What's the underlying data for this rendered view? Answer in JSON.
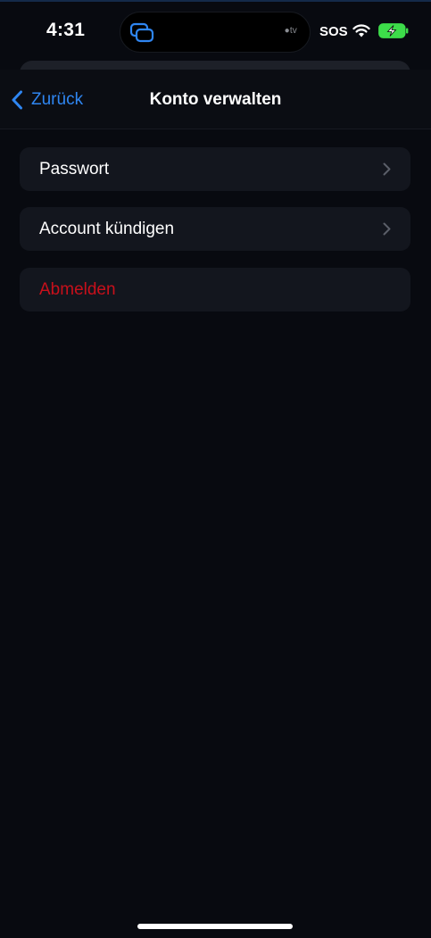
{
  "status_bar": {
    "time": "4:31",
    "island_label": "tv",
    "sos": "SOS",
    "icons": [
      "screen-mirroring-icon",
      "apple-tv-icon",
      "wifi-icon",
      "battery-charging-icon"
    ]
  },
  "nav": {
    "back_label": "Zurück",
    "title": "Konto verwalten"
  },
  "list": {
    "items": [
      {
        "label": "Passwort",
        "has_chevron": true
      },
      {
        "label": "Account kündigen",
        "has_chevron": true
      },
      {
        "label": "Abmelden",
        "has_chevron": false,
        "destructive": true
      }
    ]
  },
  "colors": {
    "background": "#080a10",
    "row_background": "#13161e",
    "accent_blue": "#2f86f2",
    "destructive_red": "#c8101b",
    "battery_green": "#3ddc4a"
  }
}
